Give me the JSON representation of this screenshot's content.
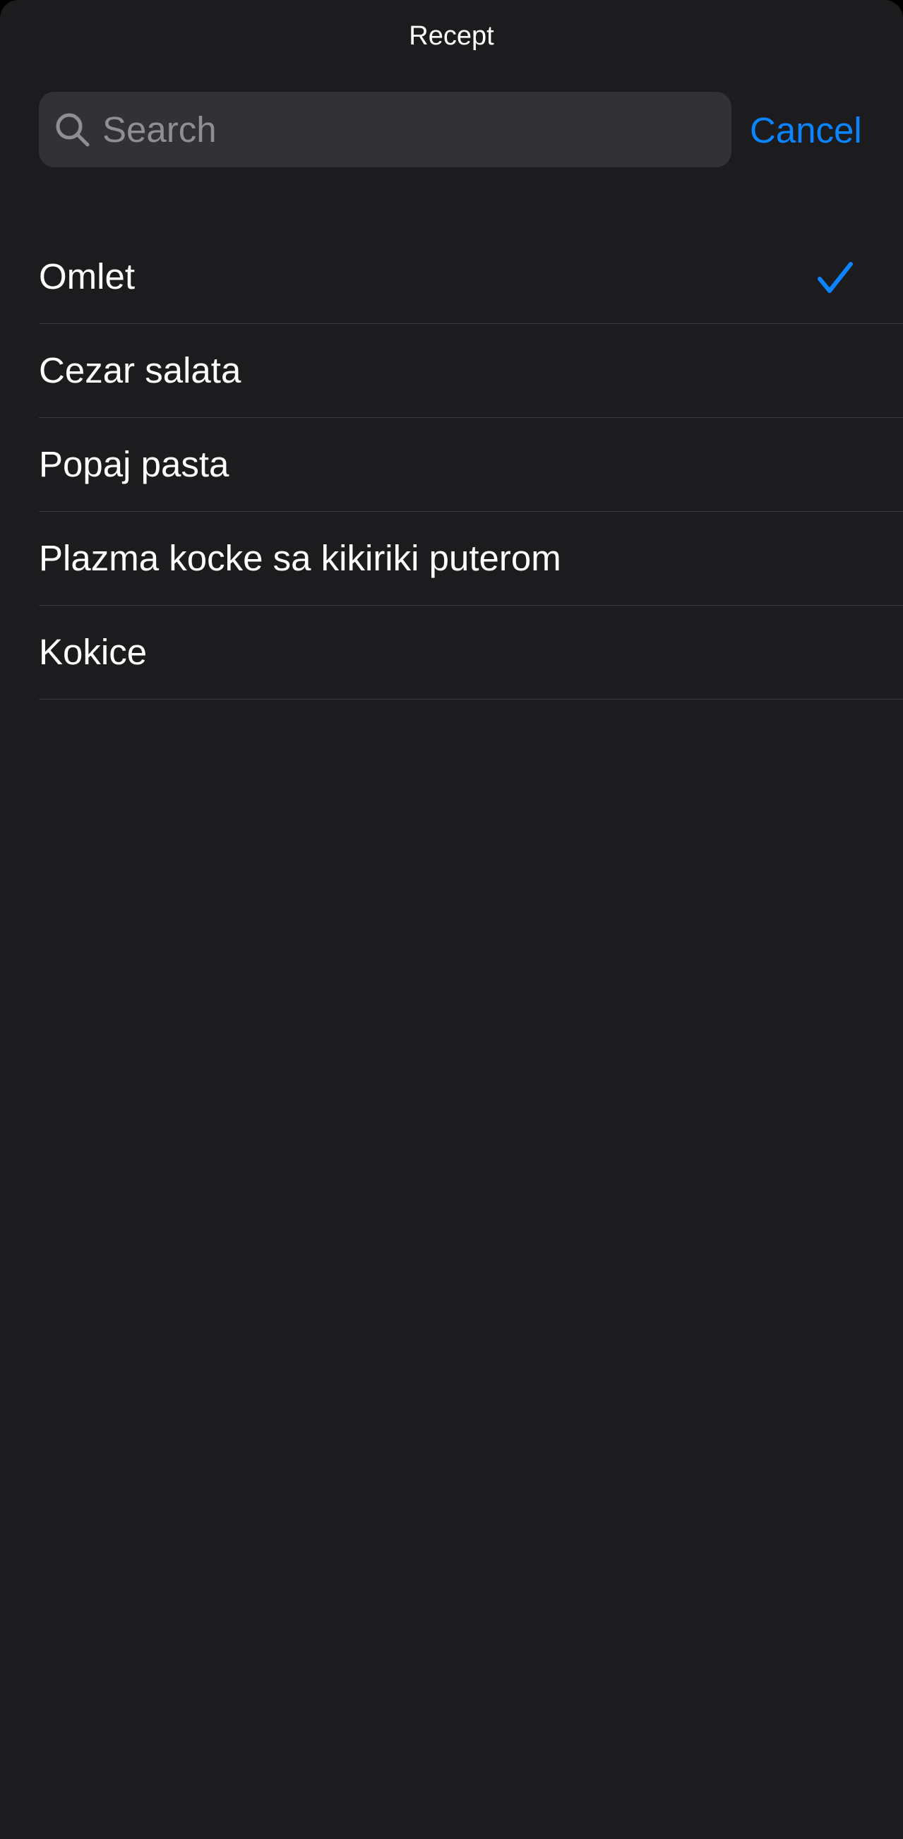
{
  "nav": {
    "title": "Recept"
  },
  "search": {
    "placeholder": "Search",
    "value": "",
    "icon": "search-icon"
  },
  "cancel_label": "Cancel",
  "colors": {
    "background": "#1c1c1e",
    "search_field": "#323236",
    "accent": "#0a84ff",
    "separator": "#3a3a3c",
    "placeholder": "#8e8e93",
    "text": "#ffffff"
  },
  "recipes": [
    {
      "label": "Omlet",
      "selected": true
    },
    {
      "label": "Cezar salata",
      "selected": false
    },
    {
      "label": "Popaj pasta",
      "selected": false
    },
    {
      "label": "Plazma kocke sa kikiriki puterom",
      "selected": false
    },
    {
      "label": "Kokice",
      "selected": false
    }
  ]
}
